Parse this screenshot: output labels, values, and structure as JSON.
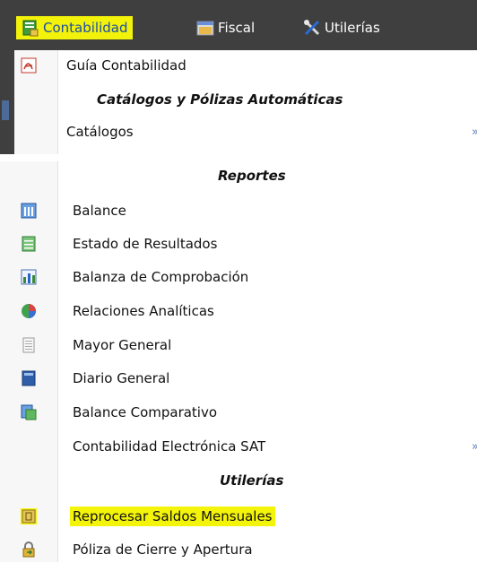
{
  "menubar": {
    "items": [
      {
        "label": "Contabilidad",
        "icon": "ledger-icon"
      },
      {
        "label": "Fiscal",
        "icon": "folder-icon"
      },
      {
        "label": "Utilerías",
        "icon": "tools-icon"
      }
    ]
  },
  "dropdown": {
    "guia": {
      "label": "Guía Contabilidad",
      "icon": "pdf-icon"
    },
    "section_catalogos": "Catálogos y Pólizas Automáticas",
    "catalogos": {
      "label": "Catálogos",
      "submenu_icon": "chevron-right-icon"
    },
    "section_reportes": "Reportes",
    "reportes": [
      {
        "label": "Balance",
        "icon": "balance-icon"
      },
      {
        "label": "Estado de Resultados",
        "icon": "document-lines-icon"
      },
      {
        "label": "Balanza de Comprobación",
        "icon": "chart-bars-icon"
      },
      {
        "label": "Relaciones Analíticas",
        "icon": "pie-globe-icon"
      },
      {
        "label": "Mayor General",
        "icon": "page-icon"
      },
      {
        "label": "Diario General",
        "icon": "book-icon"
      },
      {
        "label": "Balance Comparativo",
        "icon": "compare-icon"
      },
      {
        "label": "Contabilidad Electrónica SAT",
        "icon": "",
        "submenu_icon": "chevron-right-icon"
      }
    ],
    "section_utilerias": "Utilerías",
    "utilerias": [
      {
        "label": "Reprocesar Saldos Mensuales",
        "icon": "reprocess-icon",
        "highlighted": true
      },
      {
        "label": "Póliza de Cierre y Apertura",
        "icon": "lock-arrow-icon"
      }
    ]
  },
  "colors": {
    "menubar_bg": "#3f3f3f",
    "highlight": "#f4f40a",
    "accent_blue": "#1e4ea8"
  }
}
